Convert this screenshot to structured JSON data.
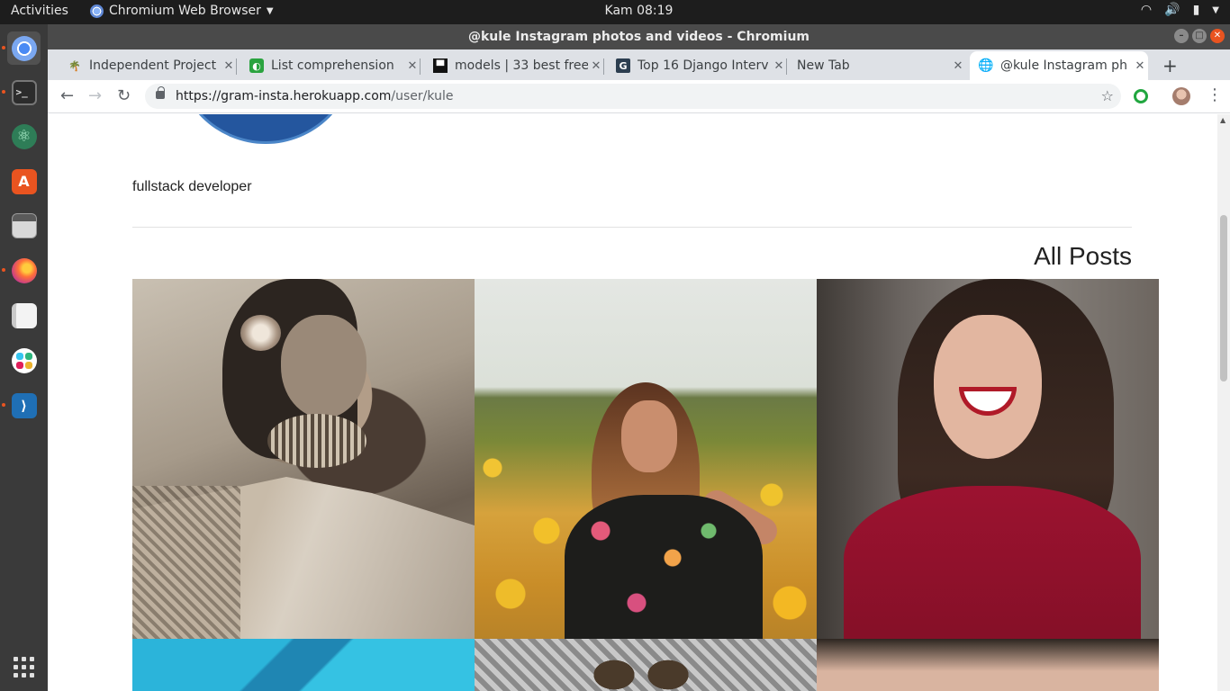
{
  "system": {
    "activities": "Activities",
    "app_menu": "Chromium Web Browser",
    "clock": "Kam 08:19"
  },
  "dock": {
    "items": [
      "chromium",
      "terminal",
      "atom",
      "software-center",
      "files",
      "firefox",
      "text-editor",
      "slack",
      "vscode",
      "show-apps"
    ]
  },
  "window": {
    "title": "@kule Instagram photos and videos - Chromium"
  },
  "tabs": [
    {
      "title": "Independent Project",
      "favicon": "tree-icon"
    },
    {
      "title": "List comprehension",
      "favicon": "green-icon"
    },
    {
      "title": "models | 33 best free",
      "favicon": "unsplash-icon"
    },
    {
      "title": "Top 16 Django Interv",
      "favicon": "g-icon"
    },
    {
      "title": "New Tab",
      "favicon": ""
    },
    {
      "title": "@kule Instagram ph",
      "favicon": "globe-icon",
      "active": true
    }
  ],
  "omnibox": {
    "url_host": "https://gram-insta.herokuapp.com",
    "url_path": "/user/kule"
  },
  "page": {
    "bio": "fullstack developer",
    "posts_heading": "All Posts"
  },
  "colors": {
    "accent": "#e95420",
    "avatar": "#24569e"
  }
}
